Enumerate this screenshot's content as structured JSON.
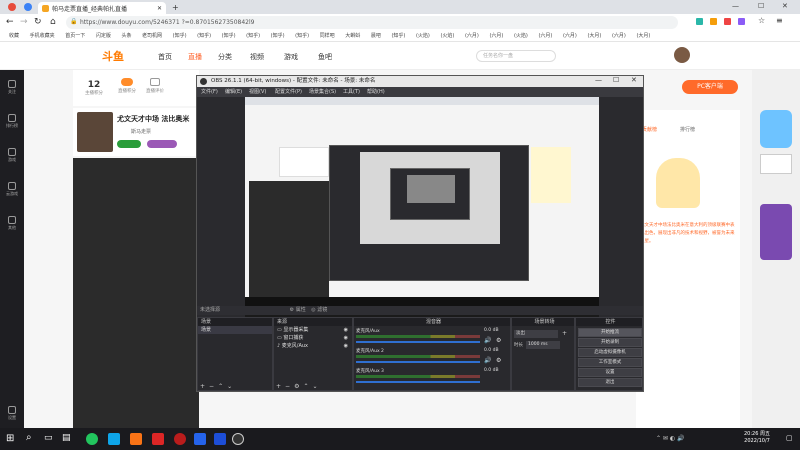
{
  "browser": {
    "tab_title": "帕马走票直播_经典帕扎直播",
    "url": "https://www.douyu.com/5246371 ?=0.87015627350842l9"
  },
  "bookmarks": [
    "收藏",
    "手机收藏夹",
    "首页一下",
    "闪定版",
    "头条",
    "老司机网",
    "(知乎)",
    "(知乎)",
    "(知乎)",
    "(知乎)",
    "(知乎)",
    "(知乎)",
    "同样吧",
    "大蝌蚪",
    "晨吧",
    "(知乎)",
    "(火焰)",
    "(火焰)",
    "(六月)",
    "(六月)",
    "(火焰)",
    "(六月)",
    "(六月)",
    "(大月)",
    "(六月)",
    "(大月)"
  ],
  "douyu": {
    "logo": "斗鱼",
    "nav": [
      "首页",
      "直播",
      "分类",
      "视频",
      "游戏",
      "鱼吧"
    ],
    "search_placeholder": "任务名你一盘",
    "stats": [
      {
        "value": "12",
        "label": "主播积分"
      },
      {
        "value": "",
        "label": "直播积分"
      },
      {
        "value": "",
        "label": "直播评价"
      }
    ],
    "sidebar": [
      "关注",
      "排行榜",
      "游戏",
      "云游戏",
      "其他",
      "设置"
    ],
    "streamer_title": "尤文天才中场 法比奥米",
    "streamer_sub": "斯马走票",
    "pc_button": "PC客户端",
    "right_tabs": [
      "贡献榜",
      "排行榜"
    ],
    "right_text": "尤文天才中场法比奥米在意大利的顶级联赛中表现出色，展现出非凡的技术和视野，被誉为未来之星。"
  },
  "obs": {
    "title": "OBS 26.1.1 (64-bit, windows) - 配置文件: 未命名 - 场景: 未命名",
    "menu": [
      "文件(F)",
      "编辑(E)",
      "视图(V)",
      "配置文件(P)",
      "场景集合(S)",
      "工具(T)",
      "帮助(H)"
    ],
    "no_source": "未选择源",
    "dock_scenes": "场景",
    "dock_sources": "来源",
    "dock_mixer": "混音器",
    "dock_transitions": "场景转场",
    "dock_controls": "控件",
    "scenes": [
      "场景"
    ],
    "sources": [
      "显示器采集",
      "窗口捕获",
      "麦克风/Aux"
    ],
    "mixer": [
      {
        "name": "麦克风/Aux",
        "db": "0.0 dB"
      },
      {
        "name": "麦克风/Aux 2",
        "db": "0.0 dB"
      },
      {
        "name": "麦克风/Aux 3",
        "db": "0.0 dB"
      }
    ],
    "transition": {
      "type": "淡出",
      "duration_label": "时长",
      "duration": "1000 ms"
    },
    "controls": [
      "开始推流",
      "开始录制",
      "启动虚拟摄像机",
      "工作室模式",
      "设置",
      "退出"
    ],
    "tab_property": "属性",
    "tab_filter": "滤镜"
  },
  "taskbar": {
    "time": "20:26 周五",
    "date": "2022/10/7"
  }
}
